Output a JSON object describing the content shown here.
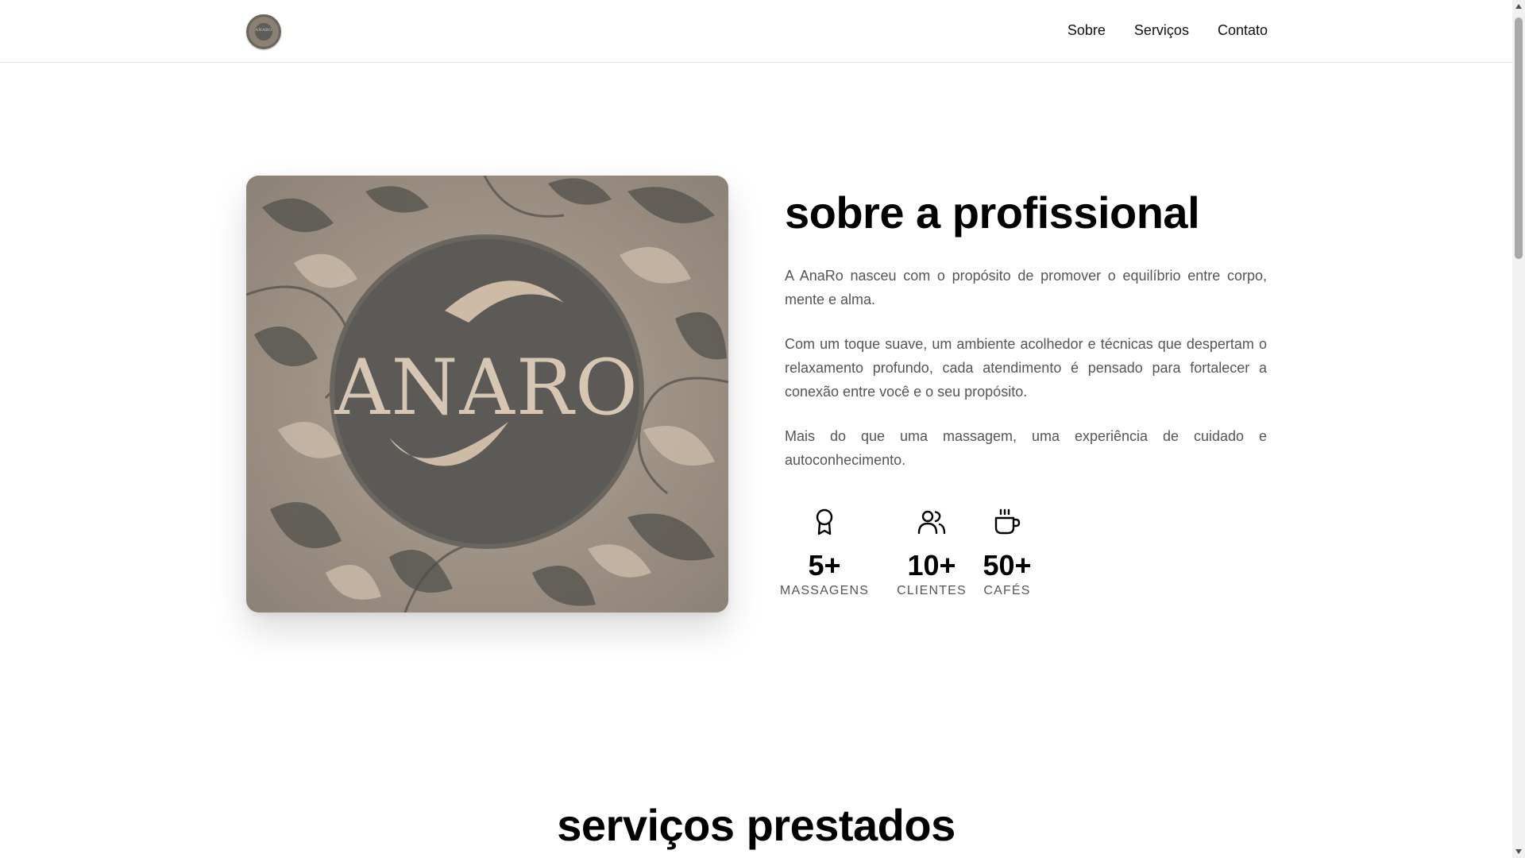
{
  "header": {
    "logo_text": "ANARO",
    "nav": [
      {
        "label": "Sobre"
      },
      {
        "label": "Serviços"
      },
      {
        "label": "Contato"
      }
    ]
  },
  "about": {
    "image_brand_text": "ANARO",
    "title": "sobre a profissional",
    "paragraphs": [
      "A AnaRo nasceu com o propósito de promover o equilíbrio entre corpo, mente e alma.",
      "Com um toque suave, um ambiente acolhedor e técnicas que despertam o relaxamento profundo, cada atendimento é pensado para fortalecer a conexão entre você e o seu propósito.",
      "Mais do que uma massagem, uma experiência de cuidado e autoconhecimento."
    ],
    "stats": [
      {
        "icon": "award-icon",
        "value": "5+",
        "label": "MASSAGENS"
      },
      {
        "icon": "users-icon",
        "value": "10+",
        "label": "CLIENTES"
      },
      {
        "icon": "coffee-icon",
        "value": "50+",
        "label": "CAFÉS"
      }
    ]
  },
  "services": {
    "title": "serviços prestados"
  },
  "colors": {
    "brand_dark": "#5b5a56",
    "brand_beige": "#c8b8a5",
    "text_muted": "#555555"
  }
}
